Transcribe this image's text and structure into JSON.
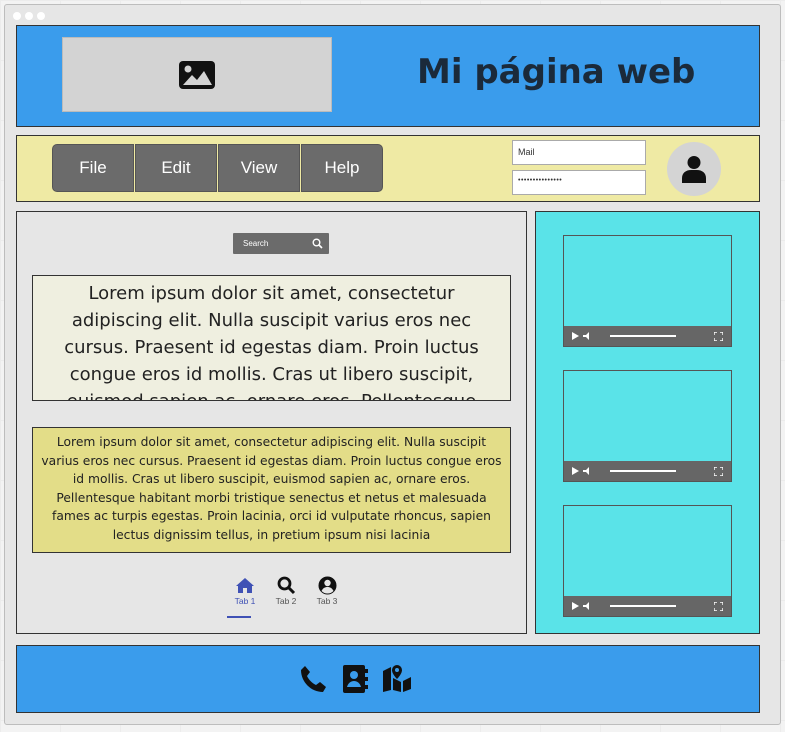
{
  "header": {
    "title": "Mi página web",
    "image_icon": "image-icon"
  },
  "menu": [
    "File",
    "Edit",
    "View",
    "Help"
  ],
  "login": {
    "mail_placeholder": "Mail",
    "password_value": "•••••••••••••••"
  },
  "search": {
    "label": "Search"
  },
  "text_large": "Lorem ipsum dolor sit amet, consectetur adipiscing elit. Nulla suscipit varius eros nec cursus. Praesent id egestas diam. Proin luctus congue eros id mollis. Cras ut libero suscipit, euismod sapien ac, ornare eros. Pellentesque",
  "text_small": "Lorem ipsum dolor sit amet, consectetur adipiscing elit. Nulla suscipit varius eros nec cursus. Praesent id egestas diam. Proin luctus congue eros id mollis. Cras ut libero suscipit, euismod sapien ac, ornare eros. Pellentesque habitant morbi tristique senectus et netus et malesuada fames ac turpis egestas. Proin lacinia, orci id vulputate rhoncus, sapien lectus dignissim tellus, in pretium ipsum nisi lacinia",
  "tabs": [
    {
      "label": "Tab 1",
      "icon": "home-icon"
    },
    {
      "label": "Tab 2",
      "icon": "search-icon"
    },
    {
      "label": "Tab 3",
      "icon": "user-icon"
    }
  ],
  "videos": 3,
  "footer_icons": [
    "phone-icon",
    "address-book-icon",
    "map-icon"
  ],
  "colors": {
    "header": "#3a9cec",
    "navbar": "#efeaa4",
    "sidebar": "#5ae3e8",
    "textbox2": "#e3dd88",
    "tab_active": "#3f51b5"
  }
}
